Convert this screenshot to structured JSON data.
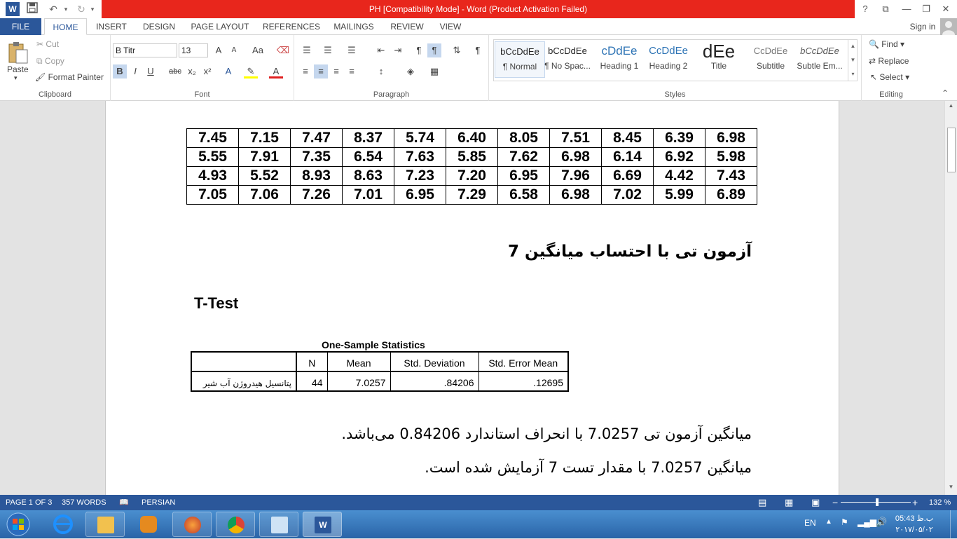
{
  "window": {
    "title": "PH [Compatibility Mode] -  Word (Product Activation Failed)",
    "help": "?",
    "controls": {
      "restore_ribbon": "⧉",
      "minimize": "—",
      "maximize": "❐",
      "close": "✕"
    }
  },
  "quick_access": {
    "save_icon": "save-icon",
    "undo_icon": "undo-icon",
    "redo_icon": "redo-icon"
  },
  "tabs": {
    "file": "FILE",
    "items": [
      "HOME",
      "INSERT",
      "DESIGN",
      "PAGE LAYOUT",
      "REFERENCES",
      "MAILINGS",
      "REVIEW",
      "VIEW"
    ],
    "active": "HOME",
    "sign_in": "Sign in"
  },
  "ribbon": {
    "clipboard": {
      "label": "Clipboard",
      "paste": "Paste",
      "cut": "Cut",
      "copy": "Copy",
      "format_painter": "Format Painter"
    },
    "font": {
      "label": "Font",
      "font_name": "B Titr",
      "font_size": "13",
      "bold": "B",
      "italic": "I",
      "underline": "U",
      "strike": "abc",
      "subscript": "x₂",
      "superscript": "x²",
      "grow": "A",
      "shrink": "A",
      "case": "Aa"
    },
    "paragraph": {
      "label": "Paragraph"
    },
    "styles": {
      "label": "Styles",
      "items": [
        {
          "preview": "bCcDdEe",
          "name": "¶ Normal"
        },
        {
          "preview": "bCcDdEe",
          "name": "¶ No Spac..."
        },
        {
          "preview": "cDdEe",
          "name": "Heading 1"
        },
        {
          "preview": "CcDdEe",
          "name": "Heading 2"
        },
        {
          "preview": "dEe",
          "name": "Title"
        },
        {
          "preview": "CcDdEe",
          "name": "Subtitle"
        },
        {
          "preview": "bCcDdEe",
          "name": "Subtle Em..."
        }
      ]
    },
    "editing": {
      "label": "Editing",
      "find": "Find",
      "replace": "Replace",
      "select": "Select"
    }
  },
  "document": {
    "number_table": [
      [
        "7.45",
        "7.15",
        "7.47",
        "8.37",
        "5.74",
        "6.40",
        "8.05",
        "7.51",
        "8.45",
        "6.39",
        "6.98"
      ],
      [
        "5.55",
        "7.91",
        "7.35",
        "6.54",
        "7.63",
        "5.85",
        "7.62",
        "6.98",
        "6.14",
        "6.92",
        "5.98"
      ],
      [
        "4.93",
        "5.52",
        "8.93",
        "8.63",
        "7.23",
        "7.20",
        "6.95",
        "7.96",
        "6.69",
        "4.42",
        "7.43"
      ],
      [
        "7.05",
        "7.06",
        "7.26",
        "7.01",
        "6.95",
        "7.29",
        "6.58",
        "6.98",
        "7.02",
        "5.99",
        "6.89"
      ]
    ],
    "heading_persian": "آزمون تی با احتساب میانگین 7",
    "ttest_heading": "T-Test",
    "stats_title": "One-Sample Statistics",
    "stats_headers": [
      "",
      "N",
      "Mean",
      "Std. Deviation",
      "Std. Error Mean"
    ],
    "stats_row": [
      "پتانسیل هیدروژن آب شیر",
      "44",
      "7.0257",
      ".84206",
      ".12695"
    ],
    "paragraph1": "میانگین آزمون تی 7.0257 با انحراف استاندارد 0.84206 می‌باشد.",
    "paragraph2": "میانگین  7.0257 با مقدار تست 7 آزمایش شده است."
  },
  "status": {
    "page": "PAGE 1 OF 3",
    "words": "357 WORDS",
    "language": "PERSIAN",
    "zoom": "132 %"
  },
  "taskbar": {
    "lang": "EN",
    "time": "05:43 ب.ظ",
    "date": "۲۰۱۷/۰۵/۰۲"
  }
}
